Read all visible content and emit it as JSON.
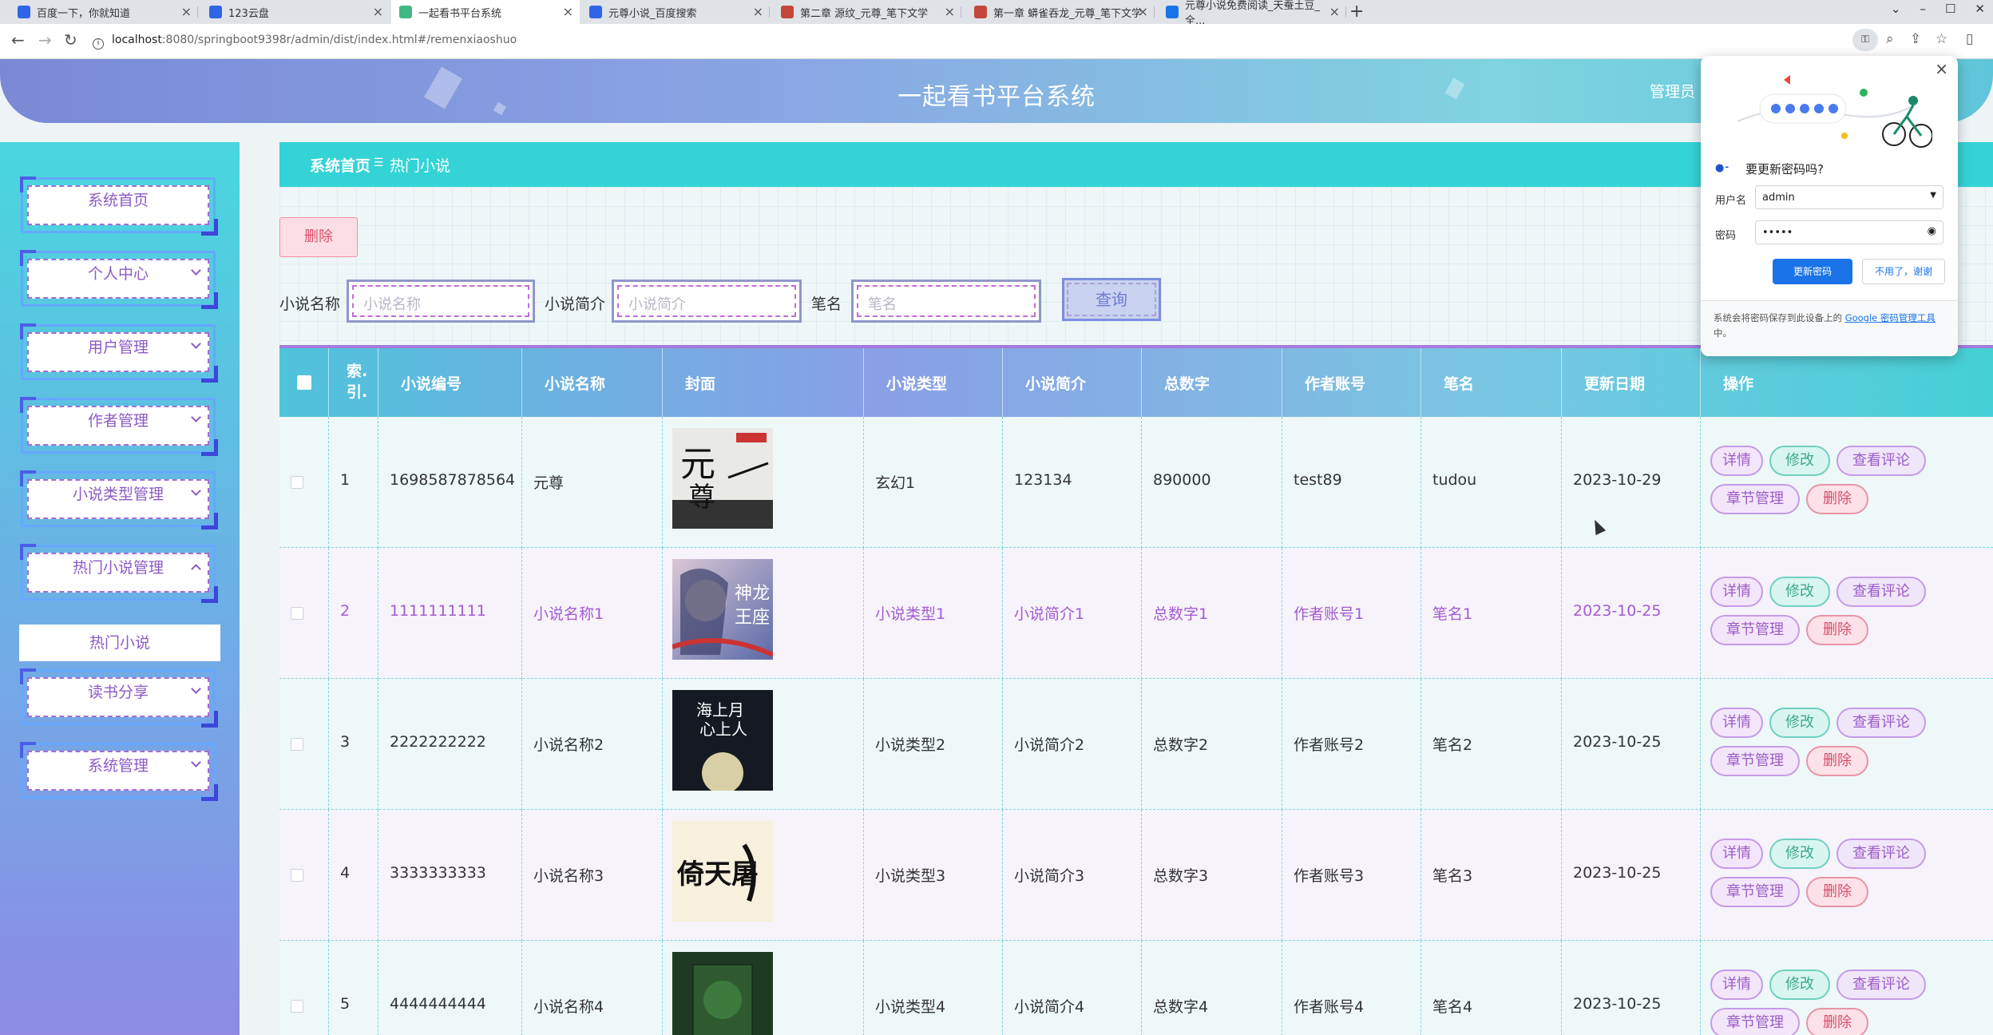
{
  "browser": {
    "tabs": [
      {
        "title": "百度一下，你就知道",
        "color": "#3064e8"
      },
      {
        "title": "123云盘",
        "color": "#3064e8"
      },
      {
        "title": "一起看书平台系统",
        "color": "#41b883"
      },
      {
        "title": "元尊小说_百度搜索",
        "color": "#3064e8"
      },
      {
        "title": "第二章 源纹_元尊_笔下文学",
        "color": "#c4473a"
      },
      {
        "title": "第一章 蟒雀吞龙_元尊_笔下文学",
        "color": "#c4473a"
      },
      {
        "title": "元尊小说免费阅读_天蚕土豆_全...",
        "color": "#1a73e8"
      }
    ],
    "url": "localhost:8080/springboot9398r/admin/dist/index.html#/remenxiaoshuo",
    "url_host": "localhost",
    "url_rest": ":8080/springboot9398r/admin/dist/index.html#/remenxiaoshuo"
  },
  "header": {
    "title": "一起看书平台系统",
    "user": "管理员"
  },
  "sidebar": {
    "items": [
      {
        "label": "系统首页",
        "chevron": "none"
      },
      {
        "label": "个人中心",
        "chevron": "down"
      },
      {
        "label": "用户管理",
        "chevron": "down"
      },
      {
        "label": "作者管理",
        "chevron": "down"
      },
      {
        "label": "小说类型管理",
        "chevron": "down"
      },
      {
        "label": "热门小说管理",
        "chevron": "up"
      },
      {
        "label": "读书分享",
        "chevron": "down"
      },
      {
        "label": "系统管理",
        "chevron": "down"
      }
    ],
    "sub_item": "热门小说"
  },
  "breadcrumb": {
    "home": "系统首页",
    "sep": "☰",
    "current": "热门小说"
  },
  "toolbar": {
    "delete": "删除"
  },
  "search": {
    "fields": [
      {
        "label": "小说名称",
        "placeholder": "小说名称"
      },
      {
        "label": "小说简介",
        "placeholder": "小说简介"
      },
      {
        "label": "笔名",
        "placeholder": "笔名"
      }
    ],
    "query": "查询"
  },
  "table": {
    "headers": [
      "索引",
      "小说编号",
      "小说名称",
      "封面",
      "小说类型",
      "小说简介",
      "总数字",
      "作者账号",
      "笔名",
      "更新日期",
      "操作"
    ],
    "index_header": "索.\n引.",
    "rows": [
      {
        "idx": "1",
        "no": "1698587878564",
        "name": "元尊",
        "type": "玄幻1",
        "intro": "123134",
        "total": "890000",
        "account": "test89",
        "pen": "tudou",
        "date": "2023-10-29"
      },
      {
        "idx": "2",
        "no": "1111111111",
        "name": "小说名称1",
        "type": "小说类型1",
        "intro": "小说简介1",
        "total": "总数字1",
        "account": "作者账号1",
        "pen": "笔名1",
        "date": "2023-10-25"
      },
      {
        "idx": "3",
        "no": "2222222222",
        "name": "小说名称2",
        "type": "小说类型2",
        "intro": "小说简介2",
        "total": "总数字2",
        "account": "作者账号2",
        "pen": "笔名2",
        "date": "2023-10-25"
      },
      {
        "idx": "4",
        "no": "3333333333",
        "name": "小说名称3",
        "type": "小说类型3",
        "intro": "小说简介3",
        "total": "总数字3",
        "account": "作者账号3",
        "pen": "笔名3",
        "date": "2023-10-25"
      },
      {
        "idx": "5",
        "no": "4444444444",
        "name": "小说名称4",
        "type": "小说类型4",
        "intro": "小说简介4",
        "total": "总数字4",
        "account": "作者账号4",
        "pen": "笔名4",
        "date": "2023-10-25"
      }
    ],
    "actions": {
      "detail": "详情",
      "edit": "修改",
      "comment": "查看评论",
      "chapter": "章节管理",
      "delete": "删除"
    },
    "highlight_row_color": "#a45bd0"
  },
  "password_popup": {
    "title": "要更新密码吗?",
    "username_label": "用户名",
    "username": "admin",
    "password_label": "密码",
    "password": "•••••",
    "update": "更新密码",
    "no_thanks": "不用了，谢谢",
    "footer_text": "系统会将密码保存到此设备上的",
    "footer_link": "Google 密码管理工具",
    "footer_suffix": "中。"
  }
}
